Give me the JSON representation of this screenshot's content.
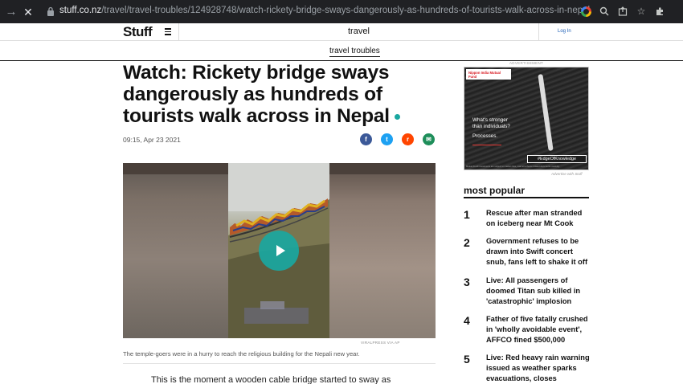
{
  "browser": {
    "url_host": "stuff.co.nz",
    "url_path": "/travel/travel-troubles/124928748/watch-rickety-bridge-sways-dangerously-as-hundreds-of-tourists-walk-across-in-nepal",
    "icons": [
      "forward-arrow-icon",
      "stop-icon",
      "lock-icon",
      "google-icon",
      "zoom-icon",
      "share-icon",
      "bookmark-star-icon",
      "extensions-icon"
    ]
  },
  "header": {
    "logo": "Stuff",
    "section": "travel",
    "login": "Log In",
    "subnav": "travel troubles"
  },
  "article": {
    "headline": "Watch: Rickety bridge sways dangerously as hundreds of tourists walk across in Nepal",
    "date": "09:15, Apr 23 2021",
    "share": [
      "f",
      "t",
      "r",
      "✉"
    ],
    "video_credit": "VIRALPRESS VIA AP",
    "caption": "The temple-goers were in a hurry to reach the religious building for the Nepali new year.",
    "body_start": "This is the moment a wooden cable bridge started to sway as"
  },
  "ad": {
    "label": "ADVERTISEMENT",
    "brand": "Nippon India Mutual Fund",
    "line1": "What's stronger",
    "line2": "than individuals?",
    "line3": "Processes.",
    "tag": "#EdgeOfKnowledge",
    "fineprint": "Mutual Fund investments are subject to market risks, read all scheme related documents carefully.",
    "credit": "Advertise with Stuff"
  },
  "most_popular": {
    "title": "most popular",
    "items": [
      {
        "num": "1",
        "text": "Rescue after man stranded on iceberg near Mt Cook"
      },
      {
        "num": "2",
        "text": "Government refuses to be drawn into Swift concert snub, fans left to shake it off"
      },
      {
        "num": "3",
        "text": "Live: All passengers of doomed Titan sub killed in 'catastrophic' implosion"
      },
      {
        "num": "4",
        "text": "Father of five fatally crushed in 'wholly avoidable event', AFFCO fined $500,000"
      },
      {
        "num": "5",
        "text": "Live: Red heavy rain warning issued as weather sparks evacuations, closes"
      }
    ]
  }
}
